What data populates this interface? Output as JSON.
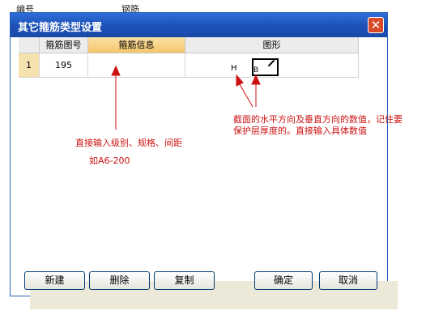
{
  "background": {
    "frag1": "编号",
    "frag2": "钢筋"
  },
  "dialog": {
    "title": "其它箍筋类型设置",
    "close_glyph": "✕",
    "columns": [
      "箍筋图号",
      "箍筋信息",
      "图形"
    ],
    "rows": [
      {
        "num": "1",
        "code": "195",
        "info": ""
      }
    ],
    "shape_labels": {
      "h": "H",
      "b": "B"
    }
  },
  "annotations": {
    "left_note_line1": "直接输入级别、规格、间距",
    "left_note_line2": "如A6-200",
    "right_note_line1": "截面的水平方向及垂直方向的数值，记住要",
    "right_note_line2": "保护层厚度的。直接输入具体数值"
  },
  "buttons": {
    "new": "新建",
    "delete": "删除",
    "copy": "复制",
    "ok": "确定",
    "cancel": "取消"
  },
  "colors": {
    "titlebar": "#1c50b6",
    "header_selected": "#f4c66a",
    "annotation": "#cc1111",
    "close": "#d84a2a"
  }
}
